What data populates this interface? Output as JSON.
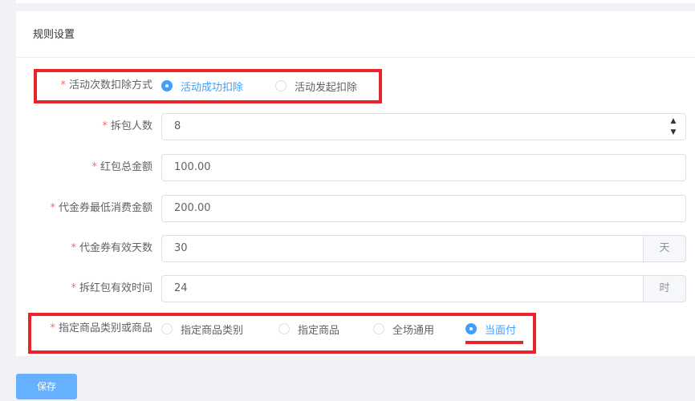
{
  "card": {
    "title": "规则设置"
  },
  "form": {
    "deduction_method": {
      "label": "活动次数扣除方式",
      "options": [
        "活动成功扣除",
        "活动发起扣除"
      ],
      "selected": "活动成功扣除"
    },
    "split_count": {
      "label": "拆包人数",
      "value": "8"
    },
    "total_amount": {
      "label": "红包总金额",
      "value": "100.00"
    },
    "min_spend": {
      "label": "代金券最低消费金额",
      "value": "200.00"
    },
    "valid_days": {
      "label": "代金券有效天数",
      "value": "30",
      "unit": "天"
    },
    "valid_hours": {
      "label": "拆红包有效时间",
      "value": "24",
      "unit": "时"
    },
    "scope": {
      "label": "指定商品类别或商品",
      "options": [
        "指定商品类别",
        "指定商品",
        "全场通用",
        "当面付"
      ],
      "selected": "当面付"
    },
    "required_mark": "*"
  },
  "actions": {
    "save_label": "保存"
  },
  "colors": {
    "accent": "#409eff",
    "required": "#f56c6c",
    "annotation": "#e8242b",
    "save_button": "#66b1ff"
  }
}
